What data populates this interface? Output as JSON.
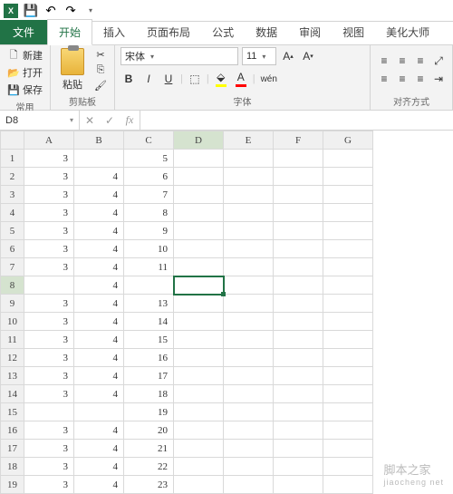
{
  "app": {
    "icon_letter": "X"
  },
  "qat": {
    "save": "💾",
    "undo": "↶",
    "redo": "↷",
    "dd": "▾"
  },
  "tabs": {
    "file": "文件",
    "home": "开始",
    "insert": "插入",
    "layout": "页面布局",
    "formula": "公式",
    "data": "数据",
    "review": "审阅",
    "view": "视图",
    "beauty": "美化大师"
  },
  "groups": {
    "common": "常用",
    "clipboard": "剪贴板",
    "font": "字体",
    "align": "对齐方式"
  },
  "common": {
    "new": "新建",
    "open": "打开",
    "save": "保存"
  },
  "clipboard": {
    "paste": "粘贴"
  },
  "font": {
    "name": "宋体",
    "size": "11",
    "bold": "B",
    "italic": "I",
    "underline": "U",
    "wen": "wén"
  },
  "la": "⬚",
  "fa": "A",
  "namebox": {
    "ref": "D8"
  },
  "fx": {
    "cancel": "✕",
    "ok": "✓",
    "fx": "fx",
    "value": ""
  },
  "cols": [
    "A",
    "B",
    "C",
    "D",
    "E",
    "F",
    "G"
  ],
  "rows": [
    {
      "n": "1",
      "a": "3",
      "b": "",
      "c": "5"
    },
    {
      "n": "2",
      "a": "3",
      "b": "4",
      "c": "6"
    },
    {
      "n": "3",
      "a": "3",
      "b": "4",
      "c": "7"
    },
    {
      "n": "4",
      "a": "3",
      "b": "4",
      "c": "8"
    },
    {
      "n": "5",
      "a": "3",
      "b": "4",
      "c": "9"
    },
    {
      "n": "6",
      "a": "3",
      "b": "4",
      "c": "10"
    },
    {
      "n": "7",
      "a": "3",
      "b": "4",
      "c": "11"
    },
    {
      "n": "8",
      "a": "",
      "b": "4",
      "c": ""
    },
    {
      "n": "9",
      "a": "3",
      "b": "4",
      "c": "13"
    },
    {
      "n": "10",
      "a": "3",
      "b": "4",
      "c": "14"
    },
    {
      "n": "11",
      "a": "3",
      "b": "4",
      "c": "15"
    },
    {
      "n": "12",
      "a": "3",
      "b": "4",
      "c": "16"
    },
    {
      "n": "13",
      "a": "3",
      "b": "4",
      "c": "17"
    },
    {
      "n": "14",
      "a": "3",
      "b": "4",
      "c": "18"
    },
    {
      "n": "15",
      "a": "",
      "b": "",
      "c": "19"
    },
    {
      "n": "16",
      "a": "3",
      "b": "4",
      "c": "20"
    },
    {
      "n": "17",
      "a": "3",
      "b": "4",
      "c": "21"
    },
    {
      "n": "18",
      "a": "3",
      "b": "4",
      "c": "22"
    },
    {
      "n": "19",
      "a": "3",
      "b": "4",
      "c": "23"
    }
  ],
  "active": {
    "row": 8,
    "col": "D"
  },
  "watermark": {
    "l1": "脚本之家",
    "l2": "jiaocheng net"
  }
}
